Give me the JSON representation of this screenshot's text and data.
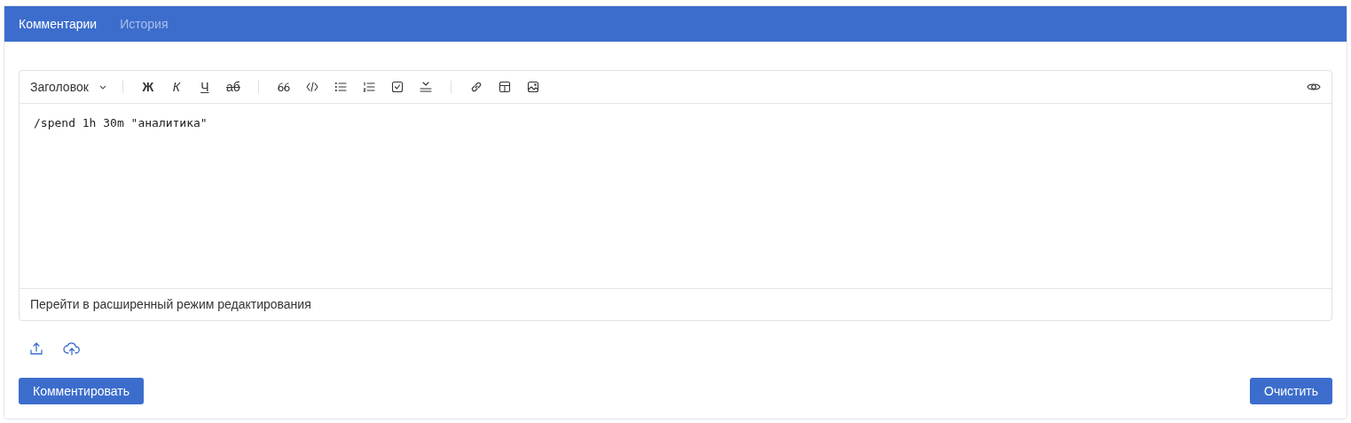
{
  "tabs": [
    {
      "label": "Комментарии",
      "selected": true
    },
    {
      "label": "История",
      "selected": false
    }
  ],
  "toolbar": {
    "heading_dropdown": "Заголовок",
    "format_buttons": [
      {
        "label": "Ж",
        "kind": "bold"
      },
      {
        "label": "К",
        "kind": "italic"
      },
      {
        "label": "Ч",
        "kind": "underline"
      },
      {
        "label": "аб",
        "kind": "strike"
      }
    ]
  },
  "editor": {
    "value": "/spend 1h 30m \"аналитика\""
  },
  "editor_footer_link": "Перейти в расширенный режим редактирования",
  "buttons": {
    "submit": "Комментировать",
    "clear": "Очистить"
  }
}
